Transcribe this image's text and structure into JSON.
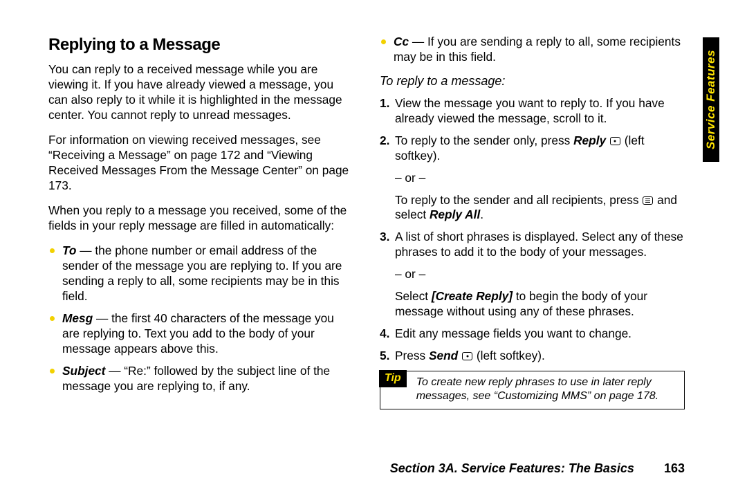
{
  "sideTab": "Service Features",
  "footer": {
    "section": "Section 3A. Service Features: The Basics",
    "page": "163"
  },
  "left": {
    "title": "Replying to a Message",
    "p1": "You can reply to a received message while you are viewing it. If you have already viewed a message, you can also reply to it while it is highlighted in the message center. You cannot reply to unread messages.",
    "p2": "For information on viewing received messages, see “Receiving a Message” on page 172 and “Viewing Received Messages From the Message Center” on page 173.",
    "p3": "When you reply to a message you received, some of the fields in your reply message are filled in automatically:",
    "bullets": {
      "to": {
        "label": "To",
        "text": " — the phone number or email address of the sender of the message you are replying to. If you are sending a reply to all, some recipients may be in this field."
      },
      "mesg": {
        "label": "Mesg",
        "text": " — the first 40 characters of the message you are replying to. Text you add to the body of your message appears above this."
      },
      "subject": {
        "label": "Subject",
        "text": " — “Re:” followed by the subject line of the message you are replying to, if any."
      }
    }
  },
  "right": {
    "cc": {
      "label": "Cc",
      "text": " — If you are sending a reply to all, some recipients may be in this field."
    },
    "lead": "To reply to a message:",
    "steps": {
      "s1": "View the message you want to reply to. If you have already viewed the message, scroll to it.",
      "s2a": "To reply to the sender only, press ",
      "s2_reply": "Reply",
      "s2b": " (left softkey).",
      "or": "– or –",
      "s2c": "To reply to the sender and all recipients, press ",
      "s2d": " and select ",
      "s2_replyall": "Reply All",
      "s2e": ".",
      "s3a": "A list of short phrases is displayed. Select any of these phrases to add it to the body of your messages.",
      "s3b": "Select ",
      "s3_cr": "[Create Reply]",
      "s3c": " to begin the body of your message without using any of these phrases.",
      "s4": "Edit any message fields you want to change.",
      "s5a": "Press ",
      "s5_send": "Send",
      "s5b": " (left softkey)."
    },
    "tip": {
      "label": "Tip",
      "text": "To create new reply phrases to use in later reply messages, see “Customizing MMS” on page 178."
    }
  }
}
